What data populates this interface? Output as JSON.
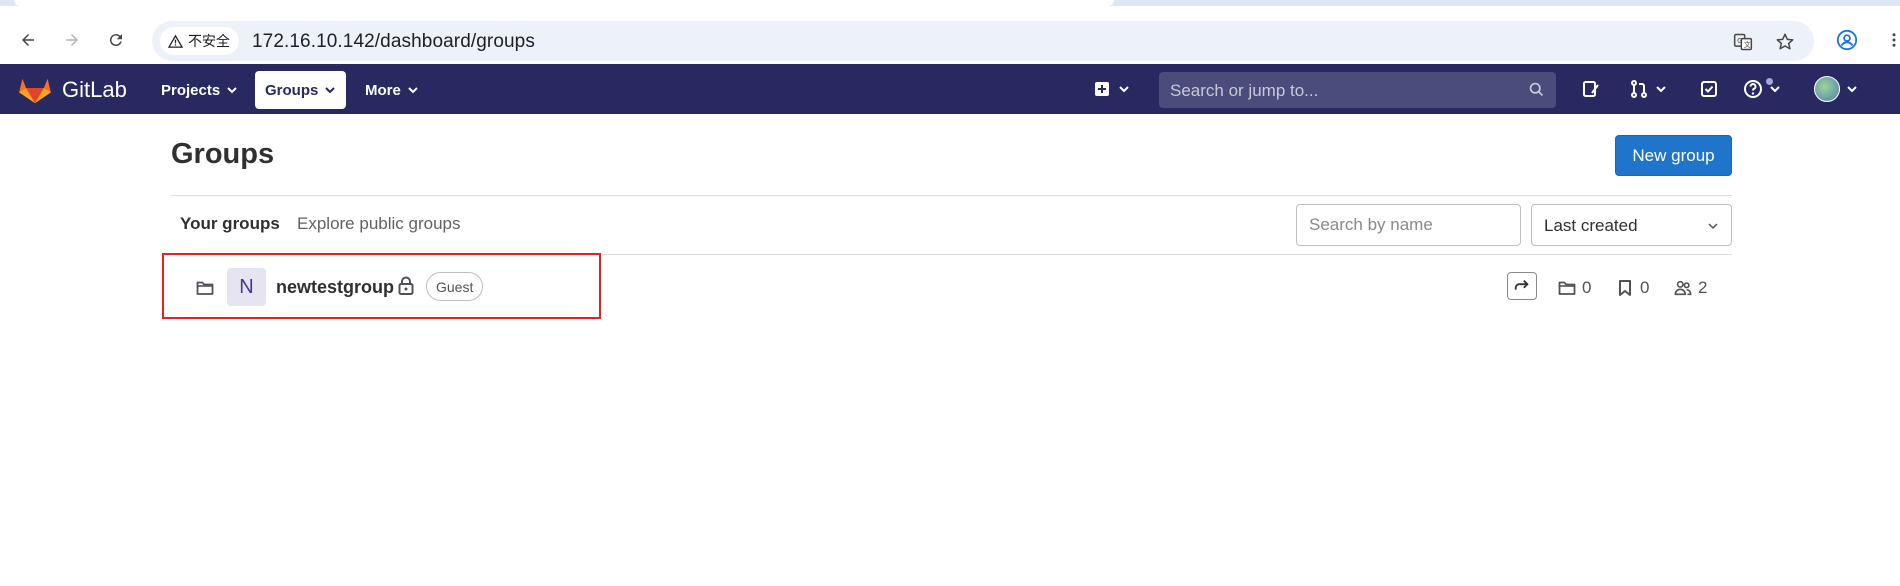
{
  "browser": {
    "security_label": "不安全",
    "url": "172.16.10.142/dashboard/groups"
  },
  "header": {
    "brand": "GitLab",
    "nav": [
      {
        "label": "Projects"
      },
      {
        "label": "Groups"
      },
      {
        "label": "More"
      }
    ],
    "search_placeholder": "Search or jump to..."
  },
  "page": {
    "title": "Groups",
    "new_group_label": "New group",
    "tabs": [
      {
        "label": "Your groups",
        "active": true
      },
      {
        "label": "Explore public groups",
        "active": false
      }
    ],
    "filter_placeholder": "Search by name",
    "sort_selected": "Last created"
  },
  "groups": [
    {
      "avatar_letter": "N",
      "name": "newtestgroup",
      "visibility": "private",
      "role": "Guest",
      "subgroups": "0",
      "projects": "0",
      "members": "2"
    }
  ],
  "colors": {
    "header_bg": "#292961",
    "primary": "#1f75cb",
    "highlight": "#e02424"
  }
}
